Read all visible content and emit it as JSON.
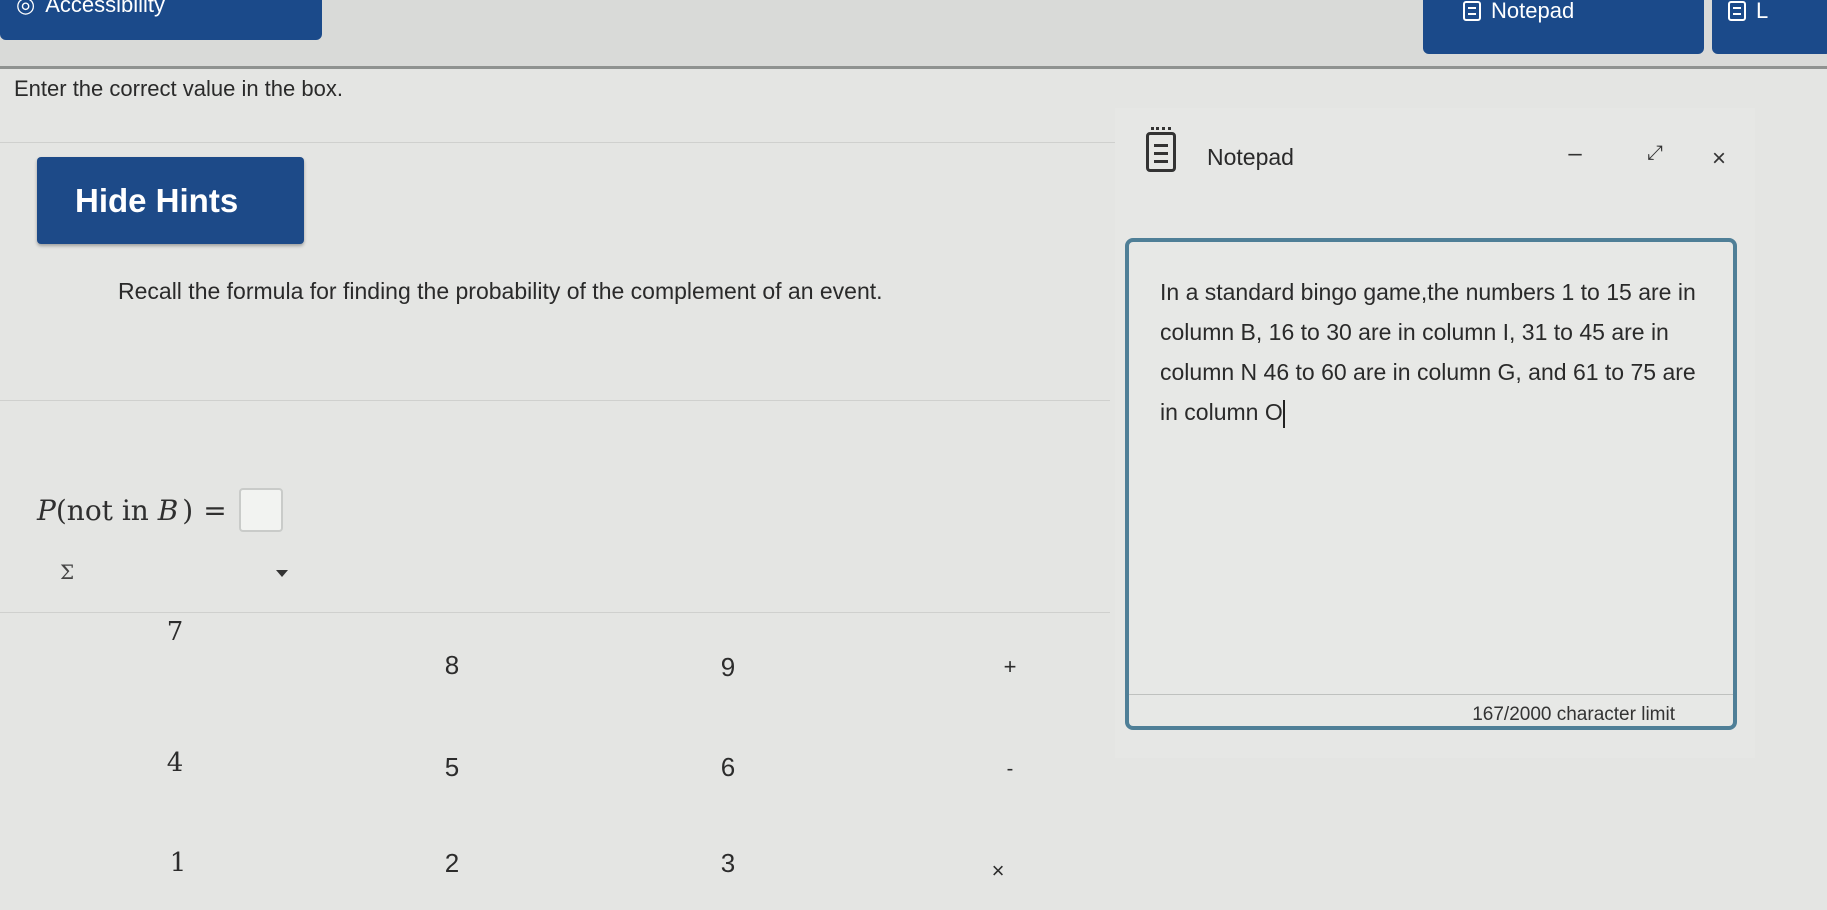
{
  "toolbar": {
    "accessibility_label": "Accessibility",
    "notepad_label": "Notepad",
    "next_label": "L"
  },
  "question": {
    "prompt": "Enter the correct value in the box."
  },
  "hints": {
    "toggle_label": "Hide Hints",
    "text": "Recall the formula for finding the probability of the complement of an event."
  },
  "equation": {
    "lhs_p": "P",
    "lhs_open": "(",
    "lhs_not_in": "not in ",
    "lhs_b": "B",
    "lhs_close": ")",
    "equals": "="
  },
  "palette": {
    "sigma_label": "Σ",
    "keys": [
      "7",
      "8",
      "9",
      "+",
      "4",
      "5",
      "6",
      "-",
      "1",
      "2",
      "3",
      "×"
    ]
  },
  "notepad": {
    "title": "Notepad",
    "minimize": "–",
    "expand": "⤢",
    "close": "×",
    "text": "In a standard bingo game,the numbers 1 to 15 are in column B, 16 to 30 are in column I, 31 to 45 are in column N 46 to 60 are in column G, and 61 to 75 are in column O",
    "char_limit": "167/2000 character limit"
  }
}
